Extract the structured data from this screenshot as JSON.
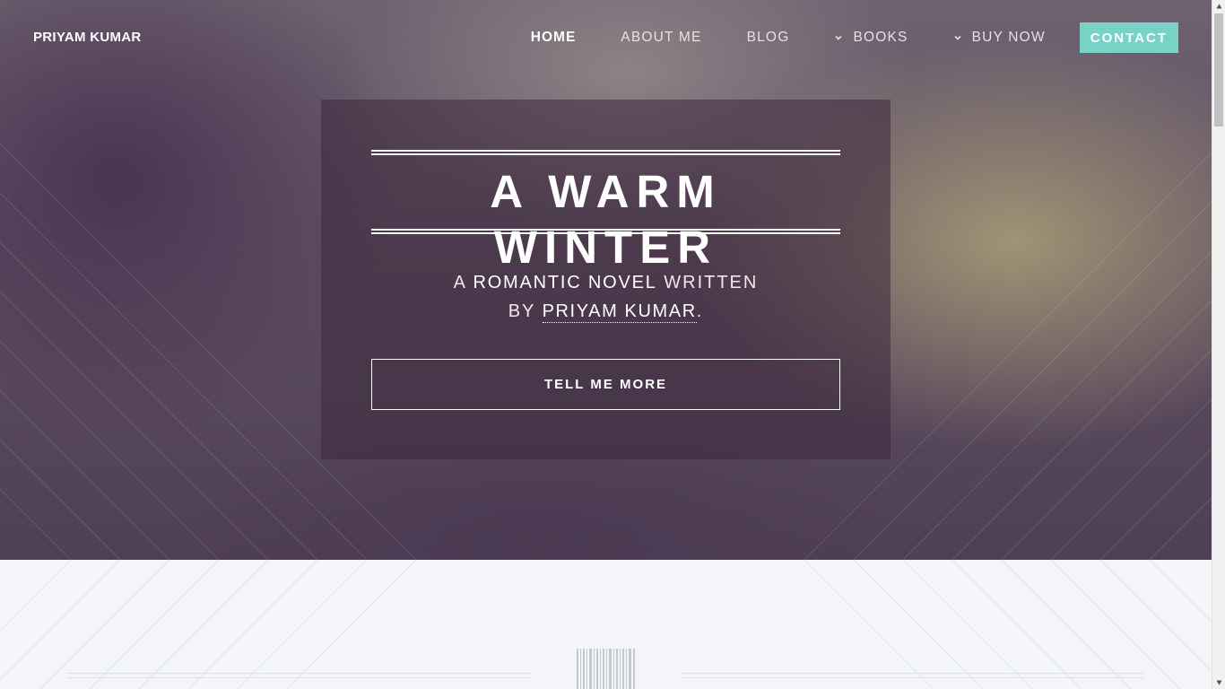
{
  "nav": {
    "brand": "PRIYAM KUMAR",
    "items": [
      {
        "label": "HOME",
        "active": true,
        "dropdown": false
      },
      {
        "label": "ABOUT ME",
        "active": false,
        "dropdown": false
      },
      {
        "label": "BLOG",
        "active": false,
        "dropdown": false
      },
      {
        "label": "BOOKS",
        "active": false,
        "dropdown": true
      },
      {
        "label": "BUY NOW",
        "active": false,
        "dropdown": true
      }
    ],
    "contact_label": "CONTACT"
  },
  "hero": {
    "title": "A WARM WINTER",
    "subtitle": {
      "pre": "A ",
      "genre": "ROMANTIC NOVEL",
      "mid": " WRITTEN",
      "by": "BY ",
      "author": "PRIYAM KUMAR",
      "end": "."
    },
    "button_label": "TELL ME MORE"
  },
  "colors": {
    "accent": "#78d3c7",
    "text_light": "#ffffff"
  }
}
